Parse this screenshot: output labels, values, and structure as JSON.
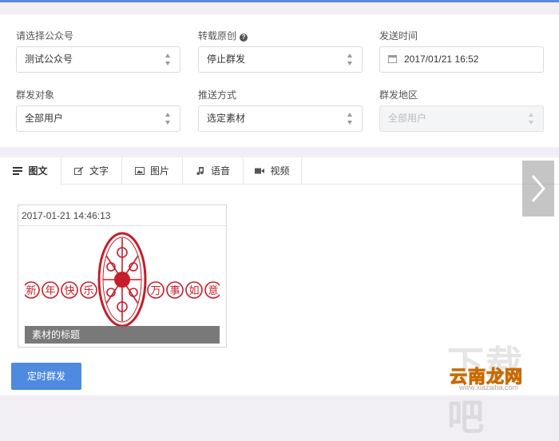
{
  "form": {
    "account": {
      "label": "请选择公众号",
      "value": "测试公众号"
    },
    "reprint": {
      "label": "转载原创",
      "value": "停止群发"
    },
    "send_time": {
      "label": "发送时间",
      "value": "2017/01/21 16:52"
    },
    "target": {
      "label": "群发对象",
      "value": "全部用户"
    },
    "push_method": {
      "label": "推送方式",
      "value": "选定素材"
    },
    "region": {
      "label": "群发地区",
      "value": "全部用户"
    }
  },
  "tabs": [
    {
      "label": "图文",
      "icon": "article-icon",
      "active": true
    },
    {
      "label": "文字",
      "icon": "edit-icon",
      "active": false
    },
    {
      "label": "图片",
      "icon": "image-icon",
      "active": false
    },
    {
      "label": "语音",
      "icon": "music-icon",
      "active": false
    },
    {
      "label": "视频",
      "icon": "video-icon",
      "active": false
    }
  ],
  "card": {
    "date": "2017-01-21 14:46:13",
    "chars": [
      "新",
      "年",
      "快",
      "乐",
      "万",
      "事",
      "如",
      "意"
    ],
    "title": "素材的标题"
  },
  "actions": {
    "schedule_label": "定时群发"
  },
  "watermark": {
    "brand": "云南龙网",
    "big": "下载吧",
    "url": "www.xiazaiba.com"
  },
  "colors": {
    "accent": "#4e8be0",
    "seal_red": "#c41e2a",
    "watermark": "#e8a000"
  }
}
